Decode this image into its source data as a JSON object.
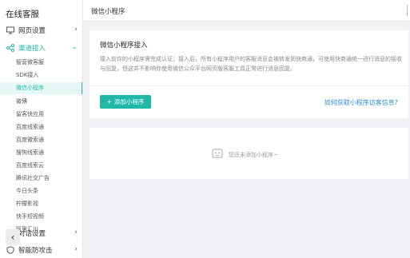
{
  "sidebar": {
    "title": "在线客服",
    "groups": [
      {
        "label": "网页设置",
        "icon": "monitor-icon"
      },
      {
        "label": "渠道接入",
        "icon": "share-icon"
      },
      {
        "label": "对话设置",
        "icon": "chat-icon"
      },
      {
        "label": "智能防攻击",
        "icon": "shield-icon"
      }
    ],
    "channel_items": [
      "智营微客服",
      "SDK接入",
      "微信小程序",
      "微博",
      "留客快应用",
      "百度线索通",
      "百度微索通",
      "搜狗线索通",
      "百度线索云",
      "腾讯社交广告",
      "今日头条",
      "柠檬影视",
      "快手短视频",
      "阿里汇川"
    ],
    "active_item": "微信小程序"
  },
  "header": {
    "title": "微信小程序"
  },
  "main": {
    "heading": "微信小程序接入",
    "description": "接入前你的小程序需完成认证；接入后，所有小程序用户的客服消息会被转发到快商通，可使用快商通统一进行消息的接收与回复，但这并不影响你使用微信公众平台网页版客服工具正常进行消息回复。",
    "add_button_label": "添加小程序",
    "help_link": "如何获取小程序访客信息?",
    "empty_text": "您还未添加小程序~"
  },
  "colors": {
    "accent": "#20b9a8",
    "link": "#2e8ed8"
  }
}
